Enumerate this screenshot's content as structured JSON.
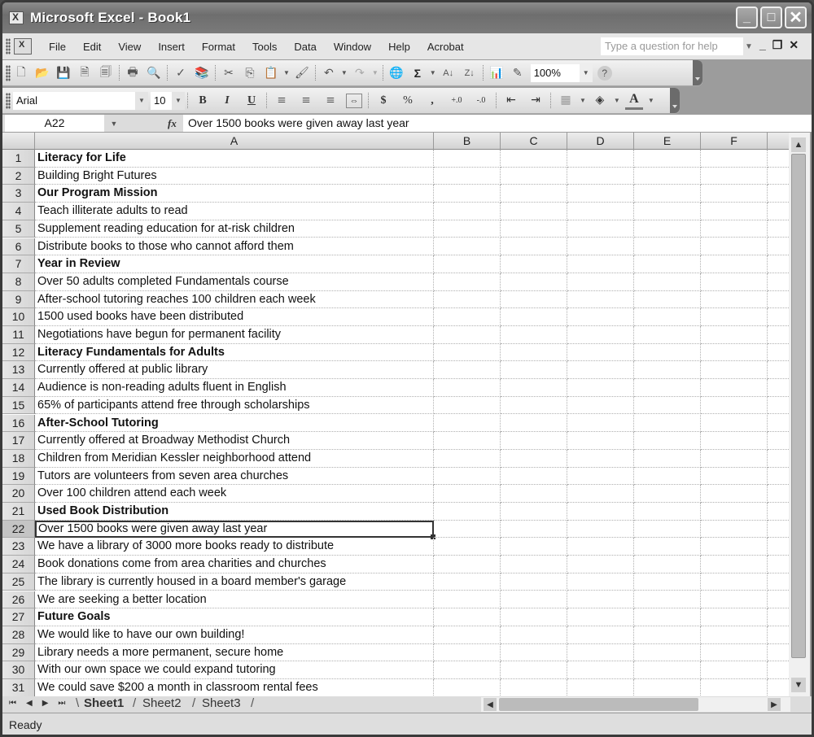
{
  "window": {
    "title": "Microsoft Excel - Book1",
    "controls": {
      "minimize": "_",
      "maximize": "□",
      "close": "✕"
    }
  },
  "menubar": {
    "items": [
      "File",
      "Edit",
      "View",
      "Insert",
      "Format",
      "Tools",
      "Data",
      "Window",
      "Help",
      "Acrobat"
    ],
    "help_placeholder": "Type a question for help",
    "mdi_controls": {
      "minimize": "_",
      "restore": "❐",
      "close": "✕"
    }
  },
  "standard_toolbar": {
    "icons": [
      "new-icon",
      "open-icon",
      "save-icon",
      "permission-icon",
      "print-area-icon",
      "print-icon",
      "print-preview-icon",
      "spelling-icon",
      "research-icon",
      "cut-icon",
      "copy-icon",
      "paste-icon",
      "format-painter-icon",
      "undo-icon",
      "redo-icon",
      "hyperlink-icon",
      "autosum-icon",
      "sort-ascending-icon",
      "sort-descending-icon",
      "chart-wizard-icon",
      "drawing-icon",
      "help-icon"
    ],
    "glyphs": {
      "new": "🗋",
      "open": "📂",
      "save": "💾",
      "permission": "🗎",
      "print_area": "🗐",
      "print": "🖶",
      "preview": "🔍",
      "spelling": "✓",
      "research": "📚",
      "cut": "✂",
      "copy": "⎘",
      "paste": "📋",
      "painter": "🖌",
      "undo": "↶",
      "redo": "↷",
      "hyperlink": "🌐",
      "autosum": "Σ",
      "sort_asc": "A↓",
      "sort_desc": "Z↓",
      "chart": "📊",
      "drawing": "✎",
      "help": "?"
    },
    "zoom": "100%"
  },
  "formatting_toolbar": {
    "font": "Arial",
    "size": "10",
    "bold": "B",
    "italic": "I",
    "underline": "U",
    "align_left": "≡",
    "align_center": "≡",
    "align_right": "≡",
    "merge_center": "⇔",
    "currency": "$",
    "percent": "%",
    "comma": ",",
    "inc_decimal": "+.0",
    "dec_decimal": "-.0",
    "dec_indent": "⇤",
    "inc_indent": "⇥",
    "borders": "▦",
    "fill_color": "◈",
    "font_color": "A"
  },
  "formula_bar": {
    "name_box": "A22",
    "fx_label": "fx",
    "content": "Over 1500 books were given away last year"
  },
  "columns": [
    "A",
    "B",
    "C",
    "D",
    "E",
    "F"
  ],
  "rows": [
    {
      "num": "1",
      "a": "Literacy for Life",
      "bold": true
    },
    {
      "num": "2",
      "a": "Building Bright Futures",
      "bold": false
    },
    {
      "num": "3",
      "a": "Our Program Mission",
      "bold": true
    },
    {
      "num": "4",
      "a": "Teach illiterate adults to read",
      "bold": false
    },
    {
      "num": "5",
      "a": "Supplement reading education for at-risk children",
      "bold": false
    },
    {
      "num": "6",
      "a": "Distribute books to those who cannot afford them",
      "bold": false
    },
    {
      "num": "7",
      "a": "Year in Review",
      "bold": true
    },
    {
      "num": "8",
      "a": "Over 50 adults completed Fundamentals course",
      "bold": false
    },
    {
      "num": "9",
      "a": "After-school tutoring reaches 100 children each week",
      "bold": false
    },
    {
      "num": "10",
      "a": "1500 used books have been distributed",
      "bold": false
    },
    {
      "num": "11",
      "a": "Negotiations have begun for permanent facility",
      "bold": false
    },
    {
      "num": "12",
      "a": "Literacy Fundamentals for Adults",
      "bold": true
    },
    {
      "num": "13",
      "a": "Currently offered at public library",
      "bold": false
    },
    {
      "num": "14",
      "a": "Audience is non-reading adults fluent in English",
      "bold": false
    },
    {
      "num": "15",
      "a": "65% of participants attend free through scholarships",
      "bold": false
    },
    {
      "num": "16",
      "a": "After-School Tutoring",
      "bold": true
    },
    {
      "num": "17",
      "a": "Currently offered at Broadway Methodist Church",
      "bold": false
    },
    {
      "num": "18",
      "a": "Children from Meridian Kessler neighborhood attend",
      "bold": false
    },
    {
      "num": "19",
      "a": "Tutors are volunteers from seven area churches",
      "bold": false
    },
    {
      "num": "20",
      "a": "Over 100 children attend each week",
      "bold": false
    },
    {
      "num": "21",
      "a": "Used Book Distribution",
      "bold": true
    },
    {
      "num": "22",
      "a": "Over 1500 books were given away last year",
      "bold": false,
      "selected": true
    },
    {
      "num": "23",
      "a": "We have a library of 3000 more books ready to distribute",
      "bold": false
    },
    {
      "num": "24",
      "a": "Book donations come from area charities and churches",
      "bold": false
    },
    {
      "num": "25",
      "a": "The library is currently housed in a board member's garage",
      "bold": false
    },
    {
      "num": "26",
      "a": "We are seeking a better location",
      "bold": false
    },
    {
      "num": "27",
      "a": "Future Goals",
      "bold": true
    },
    {
      "num": "28",
      "a": "We would like to have our own building!",
      "bold": false
    },
    {
      "num": "29",
      "a": "Library needs a more permanent, secure home",
      "bold": false
    },
    {
      "num": "30",
      "a": "With our own space we could expand tutoring",
      "bold": false
    },
    {
      "num": "31",
      "a": "We could save $200 a month in classroom rental fees",
      "bold": false
    }
  ],
  "sheet_tabs": {
    "nav": [
      "⏮",
      "◀",
      "▶",
      "⏭"
    ],
    "tabs": [
      "Sheet1",
      "Sheet2",
      "Sheet3"
    ],
    "active": "Sheet1"
  },
  "scrollbars": {
    "up": "▲",
    "down": "▼",
    "left": "◀",
    "right": "▶"
  },
  "status": {
    "text": "Ready"
  }
}
